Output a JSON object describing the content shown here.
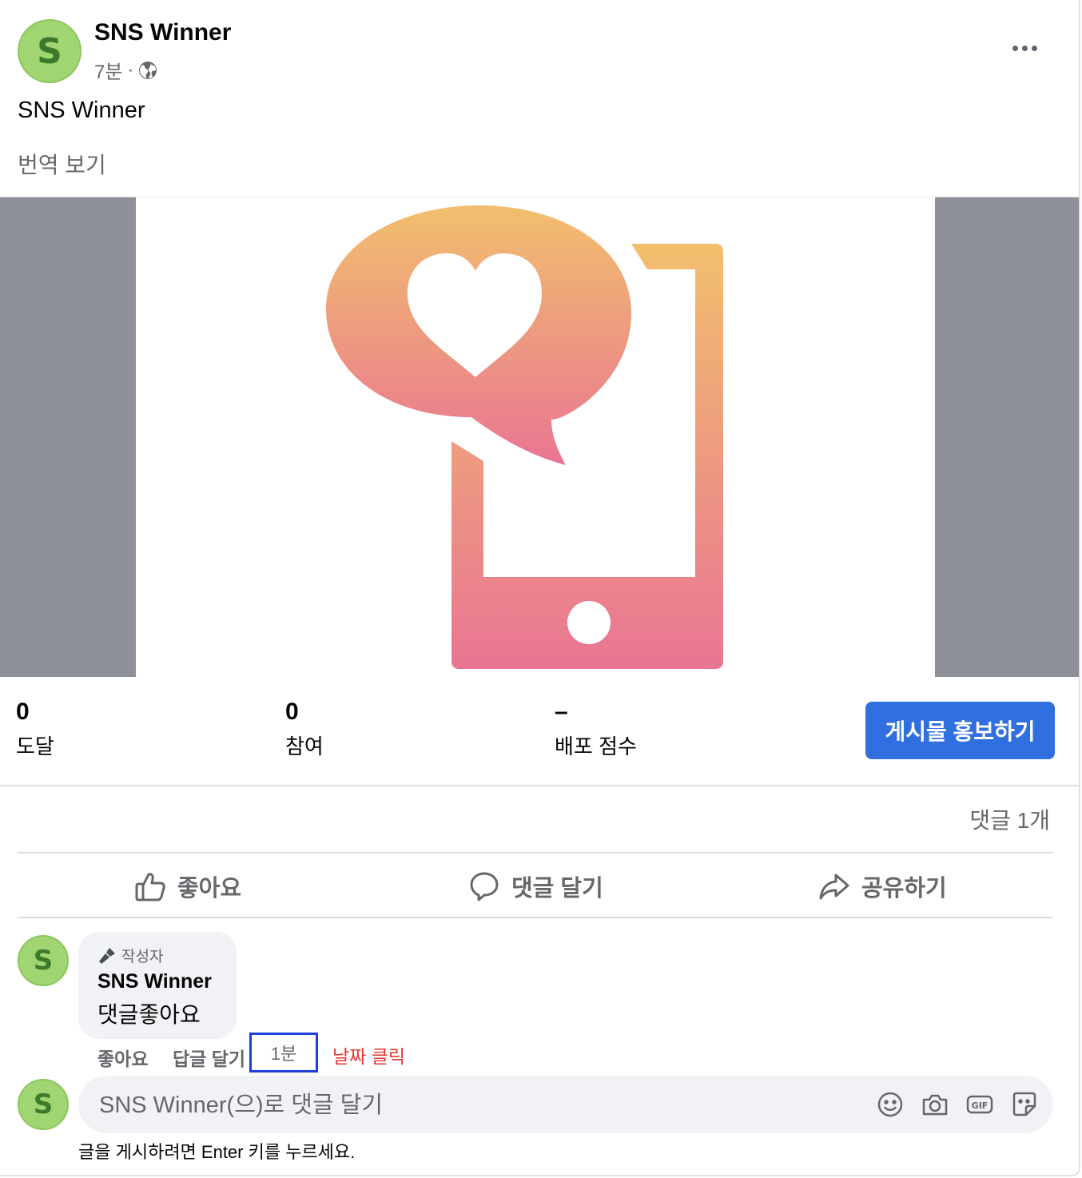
{
  "post": {
    "avatar_letter": "S",
    "author": "SNS Winner",
    "time": "7분",
    "separator": "·",
    "body": "SNS Winner",
    "translate": "번역 보기",
    "more_icon": "more-horizontal-icon",
    "audience_icon": "globe-icon"
  },
  "media": {
    "icon": "phone-heart-chat-icon",
    "gradient_top": "#f2bf6d",
    "gradient_bottom": "#e97593",
    "side_color": "#8e9097"
  },
  "insights": {
    "reach": {
      "value": "0",
      "label": "도달"
    },
    "engagement": {
      "value": "0",
      "label": "참여"
    },
    "distribution": {
      "value": "–",
      "label": "배포 점수"
    },
    "promote_label": "게시물 홍보하기",
    "promote_color": "#2f6fe0"
  },
  "comment_count": "댓글 1개",
  "actions": {
    "like": "좋아요",
    "comment": "댓글 달기",
    "share": "공유하기"
  },
  "comment": {
    "avatar_letter": "S",
    "badge": "작성자",
    "author": "SNS Winner",
    "text": "댓글좋아요",
    "like": "좋아요",
    "reply": "답글 달기",
    "time": "1분",
    "annotation": "날짜 클릭",
    "highlight_color": "#1e3fd8",
    "annotation_color": "#e53935"
  },
  "composer": {
    "avatar_letter": "S",
    "placeholder": "SNS Winner(으)로 댓글 달기",
    "hint": "글을 게시하려면 Enter 키를 누르세요.",
    "icons": [
      "emoji-icon",
      "camera-icon",
      "gif-icon",
      "sticker-icon"
    ]
  }
}
